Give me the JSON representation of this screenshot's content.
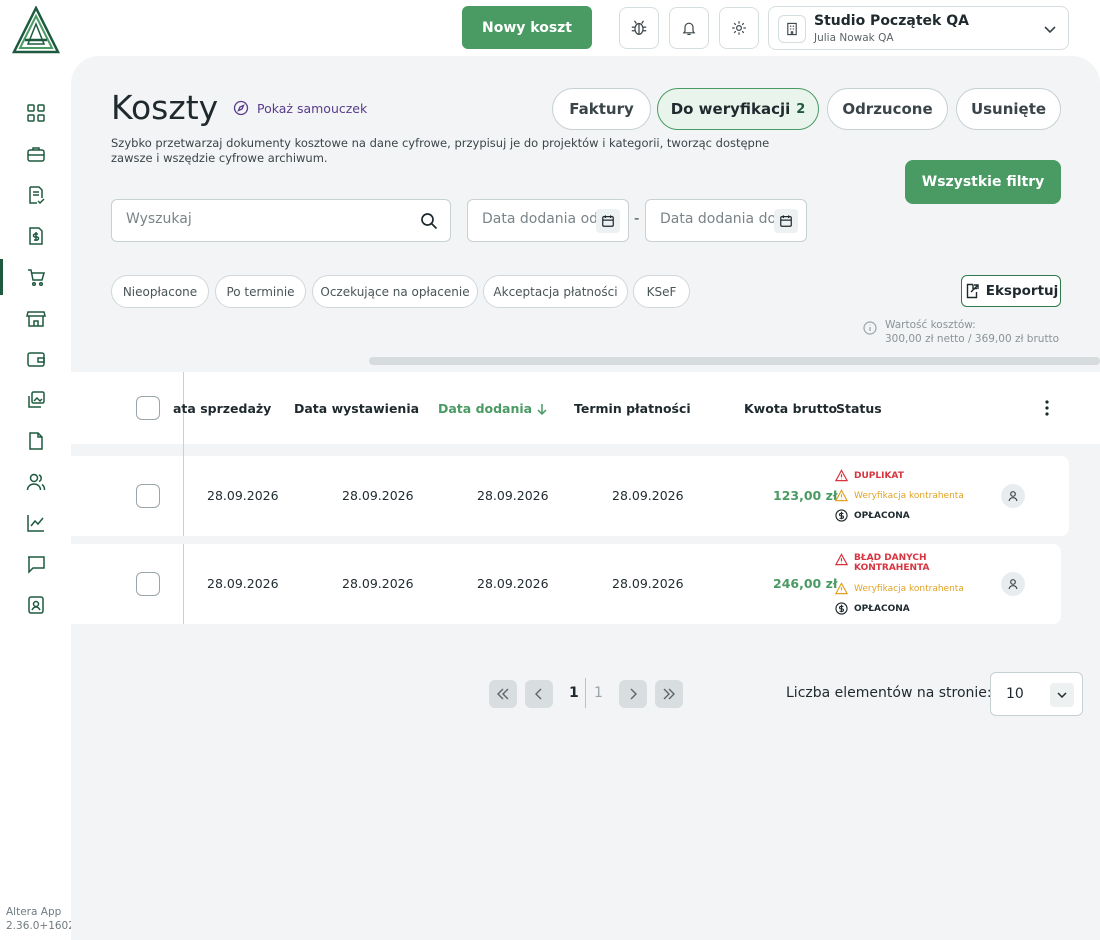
{
  "header": {
    "new_cost_label": "Nowy koszt",
    "company_name": "Studio Początek QA",
    "company_user": "Julia Nowak QA"
  },
  "sidebar": {
    "items": [
      {
        "icon": "dashboard-icon"
      },
      {
        "icon": "briefcase-icon"
      },
      {
        "icon": "invoice-check-icon"
      },
      {
        "icon": "money-document-icon"
      },
      {
        "icon": "shopping-cart-icon",
        "active": true
      },
      {
        "icon": "store-icon"
      },
      {
        "icon": "wallet-icon"
      },
      {
        "icon": "image-stack-icon"
      },
      {
        "icon": "document-icon"
      },
      {
        "icon": "users-icon"
      },
      {
        "icon": "chart-icon"
      },
      {
        "icon": "chat-icon"
      },
      {
        "icon": "contact-card-icon"
      }
    ],
    "version_app": "Altera App",
    "version_number": "2.36.0+1602"
  },
  "page": {
    "title": "Koszty",
    "tutorial_label": "Pokaż samouczek",
    "description": "Szybko przetwarzaj dokumenty kosztowe na dane cyfrowe, przypisuj je do projektów i kategorii, tworząc dostępne zawsze i wszędzie cyfrowe archiwum."
  },
  "tabs": [
    {
      "label": "Faktury",
      "count": ""
    },
    {
      "label": "Do weryfikacji",
      "count": "2"
    },
    {
      "label": "Odrzucone",
      "count": ""
    },
    {
      "label": "Usunięte",
      "count": ""
    }
  ],
  "filters": {
    "all_filters_label": "Wszystkie filtry",
    "search_placeholder": "Wyszukaj",
    "date_from_placeholder": "Data dodania od",
    "date_to_placeholder": "Data dodania do",
    "date_separator": "-",
    "chips": [
      "Nieopłacone",
      "Po terminie",
      "Oczekujące na opłacenie",
      "Akceptacja płatności",
      "KSeF"
    ],
    "export_label": "Eksportuj",
    "cost_value_label": "Wartość kosztów:",
    "cost_value": "300,00 zł netto / 369,00 zł brutto"
  },
  "table": {
    "columns": [
      "ata sprzedaży",
      "Data wystawienia",
      "Data dodania",
      "Termin płatności",
      "Kwota brutto",
      "Status"
    ],
    "rows": [
      {
        "sale_date": "28.09.2026",
        "issue_date": "28.09.2026",
        "added_date": "28.09.2026",
        "due_date": "28.09.2026",
        "amount": "123,00 zł",
        "status_1": "DUPLIKAT",
        "status_2": "Weryfikacja kontrahenta",
        "status_3": "OPŁACONA"
      },
      {
        "sale_date": "28.09.2026",
        "issue_date": "28.09.2026",
        "added_date": "28.09.2026",
        "due_date": "28.09.2026",
        "amount": "246,00 zł",
        "status_1": "BŁĄD DANYCH KONTRAHENTA",
        "status_2": "Weryfikacja kontrahenta",
        "status_3": "OPŁACONA"
      }
    ]
  },
  "pagination": {
    "current_page": "1",
    "total_pages": "1",
    "per_page_label": "Liczba elementów na stronie:",
    "per_page_value": "10"
  },
  "colors": {
    "brand_green": "#4a9a63",
    "dark_green": "#1d5a3f",
    "error_red": "#d8343f",
    "warning_orange": "#e0a324",
    "purple": "#5a3c8c"
  }
}
